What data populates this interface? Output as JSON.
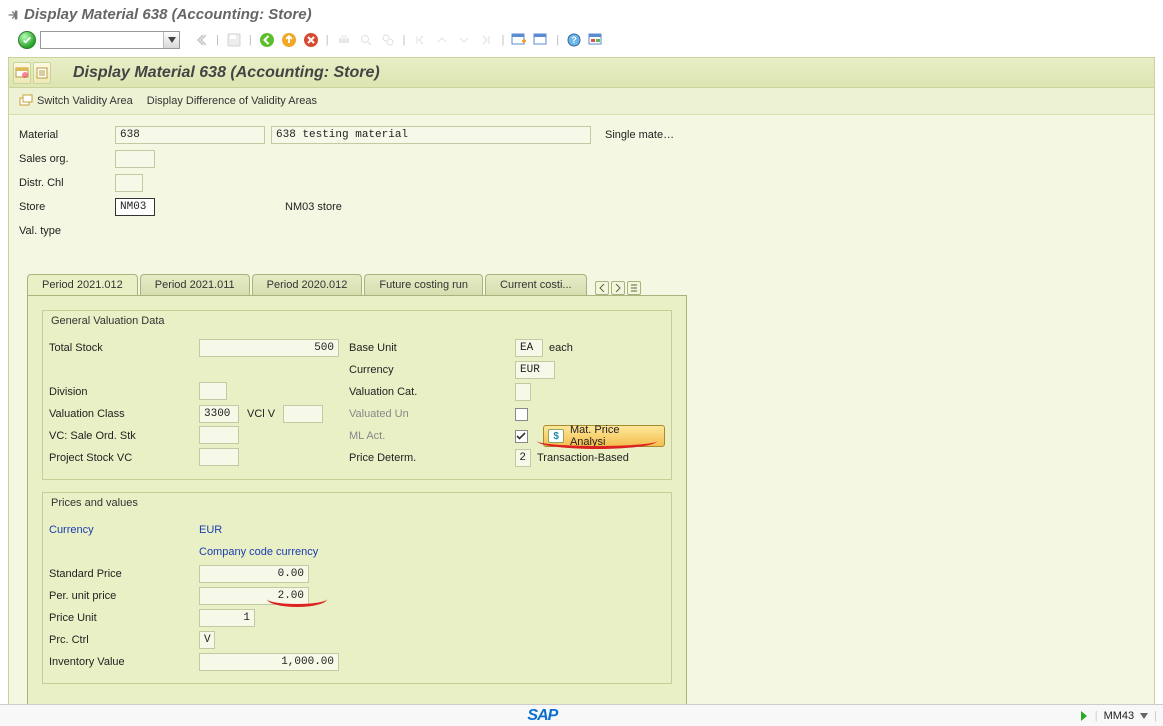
{
  "window_title": "Display Material 638 (Accounting: Store)",
  "panel_title": "Display Material 638 (Accounting: Store)",
  "sub_toolbar": {
    "switch_validity": "Switch Validity Area",
    "display_diff": "Display Difference of Validity Areas"
  },
  "header": {
    "material_label": "Material",
    "material_id": "638",
    "material_desc": "638 testing material",
    "single": "Single mate…",
    "sales_org_label": "Sales org.",
    "distr_chl_label": "Distr. Chl",
    "store_label": "Store",
    "store_val": "NM03",
    "store_desc": "NM03 store",
    "val_type_label": "Val. type"
  },
  "tabs": [
    "Period 2021.012",
    "Period 2021.011",
    "Period 2020.012",
    "Future costing run",
    "Current costi..."
  ],
  "gvd": {
    "title": "General Valuation Data",
    "total_stock_label": "Total Stock",
    "total_stock_val": "500",
    "base_unit_label": "Base Unit",
    "base_unit_val": "EA",
    "base_unit_text": "each",
    "currency_label": "Currency",
    "currency_val": "EUR",
    "division_label": "Division",
    "valuation_cat_label": "Valuation Cat.",
    "valuation_class_label": "Valuation Class",
    "valuation_class_val": "3300",
    "vcl_v_label": "VCl V",
    "valuated_un_label": "Valuated Un",
    "vc_sale_ord_label": "VC: Sale Ord. Stk",
    "ml_act_label": "ML Act.",
    "mat_price_btn": "Mat. Price Analysi",
    "project_stock_label": "Project Stock VC",
    "price_determ_label": "Price Determ.",
    "price_determ_val": "2",
    "price_determ_text": "Transaction-Based"
  },
  "prices": {
    "title": "Prices and values",
    "currency_label": "Currency",
    "currency_val": "EUR",
    "ccc": "Company code currency",
    "std_price_label": "Standard Price",
    "std_price_val": "0.00",
    "per_unit_label": "Per. unit price",
    "per_unit_val": "2.00",
    "price_unit_label": "Price Unit",
    "price_unit_val": "1",
    "prc_ctrl_label": "Prc. Ctrl",
    "prc_ctrl_val": "V",
    "inv_val_label": "Inventory Value",
    "inv_val_val": "1,000.00"
  },
  "status": {
    "tcode": "MM43"
  }
}
